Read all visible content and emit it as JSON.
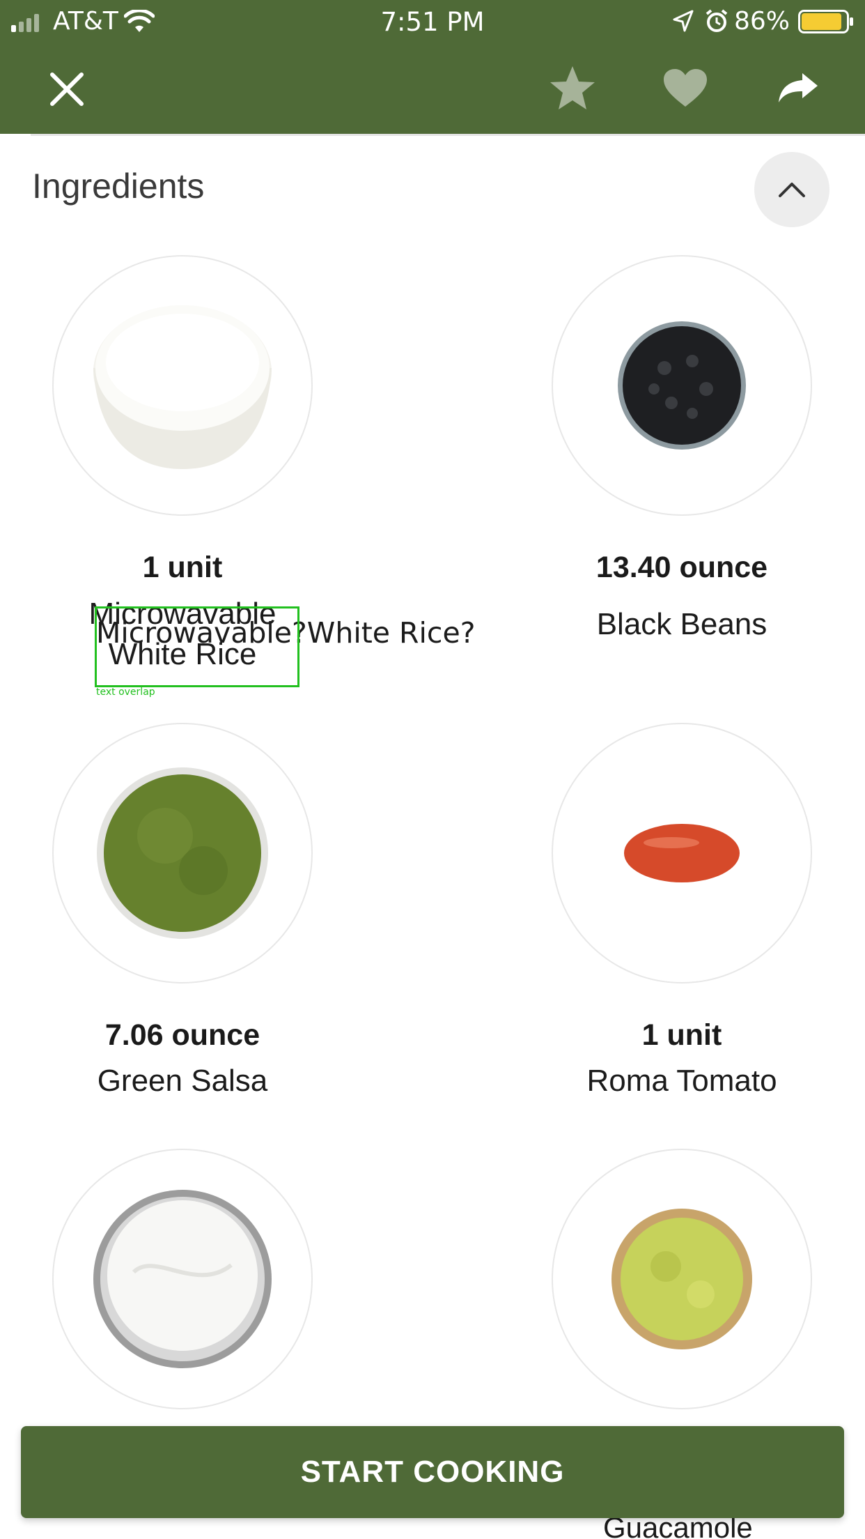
{
  "status_bar": {
    "carrier": "AT&T",
    "time": "7:51 PM",
    "battery_percent": "86%"
  },
  "header": {
    "icons": [
      "close-icon",
      "star-icon",
      "heart-icon",
      "share-icon"
    ]
  },
  "section": {
    "title": "Ingredients"
  },
  "ingredients": [
    {
      "quantity": "1 unit",
      "name": "Microwavable White Rice",
      "image": "rice-bowl"
    },
    {
      "quantity": "13.40 ounce",
      "name": "Black Beans",
      "image": "black-beans-bowl"
    },
    {
      "quantity": "7.06 ounce",
      "name": "Green Salsa",
      "image": "green-salsa-bowl"
    },
    {
      "quantity": "1 unit",
      "name": "Roma Tomato",
      "image": "roma-tomato"
    },
    {
      "quantity": "",
      "name": "",
      "image": "sour-cream-bowl"
    },
    {
      "quantity": "",
      "name": "Guacamole",
      "image": "guacamole-bowl"
    }
  ],
  "overlap_text": "Microwavable?White  Rice?",
  "overlap_tag": "text overlap",
  "cta": {
    "label": "START COOKING"
  },
  "colors": {
    "brand_green": "#4f6a37",
    "overlay_green": "#22c01f"
  }
}
